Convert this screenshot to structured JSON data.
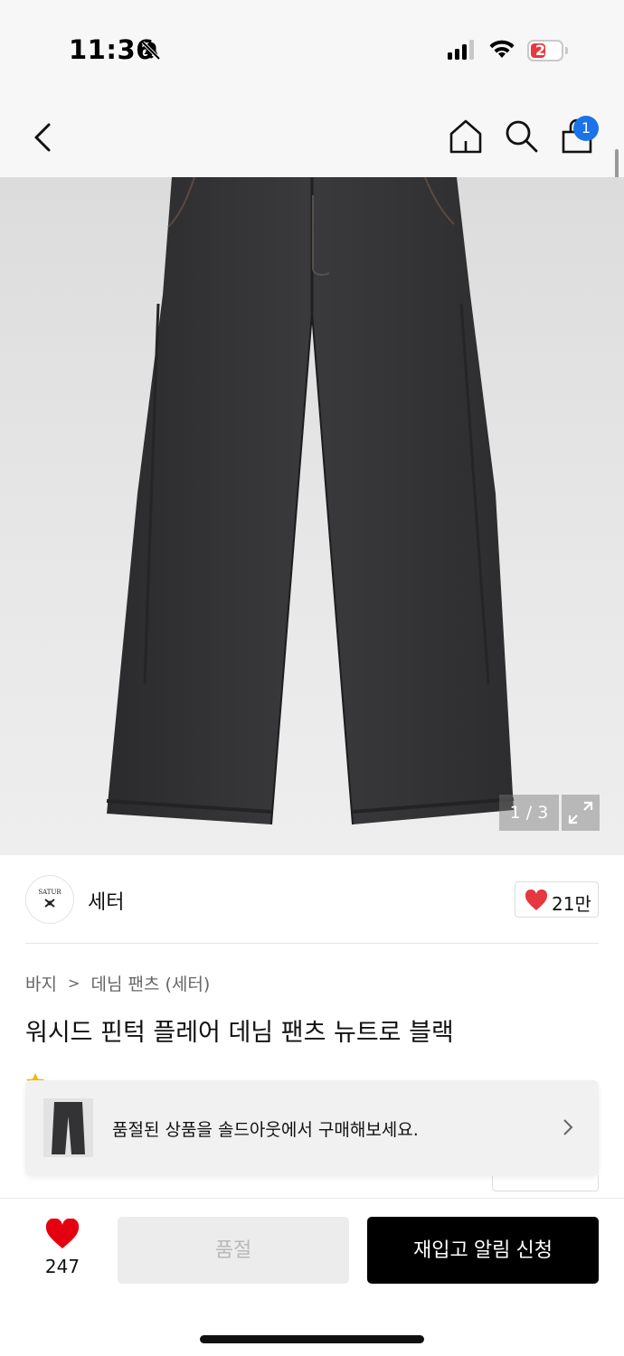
{
  "status_bar": {
    "time": "11:36",
    "battery_level": "20",
    "icons": [
      "bell-slash-icon",
      "signal-icon",
      "wifi-icon",
      "battery-icon"
    ]
  },
  "nav": {
    "icons": [
      "back-icon",
      "home-icon",
      "search-icon",
      "cart-icon"
    ],
    "cart_badge": "1"
  },
  "product_image": {
    "counter": "1 / 3",
    "image_count": 3,
    "current_index": 1
  },
  "brand": {
    "logo_text": "SATUR",
    "name": "세터",
    "like_count": "21만"
  },
  "breadcrumb": {
    "category": "바지",
    "separator": ">",
    "subcategory": "데님 팬츠 (세터)"
  },
  "product": {
    "title": "워시드 핀턱 플레어 데님 팬츠 뉴트로 블랙"
  },
  "toast": {
    "message": "품절된 상품을 솔드아웃에서 구매해보세요."
  },
  "bottom_bar": {
    "like_count": "247",
    "soldout_label": "품절",
    "restock_label": "재입고 알림 신청"
  },
  "colors": {
    "accent_red": "#e5393f",
    "badge_blue": "#1a73e8",
    "primary_black": "#000000",
    "disabled_gray": "#ececec"
  }
}
